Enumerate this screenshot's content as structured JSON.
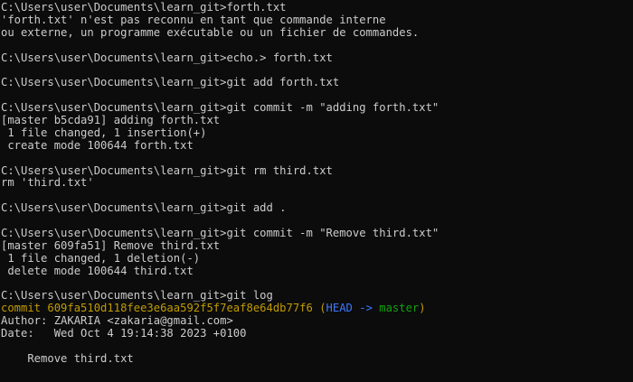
{
  "terminal": {
    "lines": [
      "C:\\Users\\user\\Documents\\learn_git>forth.txt",
      "'forth.txt' n'est pas reconnu en tant que commande interne",
      "ou externe, un programme exécutable ou un fichier de commandes.",
      "",
      "C:\\Users\\user\\Documents\\learn_git>echo.> forth.txt",
      "",
      "C:\\Users\\user\\Documents\\learn_git>git add forth.txt",
      "",
      "C:\\Users\\user\\Documents\\learn_git>git commit -m \"adding forth.txt\"",
      "[master b5cda91] adding forth.txt",
      " 1 file changed, 1 insertion(+)",
      " create mode 100644 forth.txt",
      "",
      "C:\\Users\\user\\Documents\\learn_git>git rm third.txt",
      "rm 'third.txt'",
      "",
      "C:\\Users\\user\\Documents\\learn_git>git add .",
      "",
      "C:\\Users\\user\\Documents\\learn_git>git commit -m \"Remove third.txt\"",
      "[master 609fa51] Remove third.txt",
      " 1 file changed, 1 deletion(-)",
      " delete mode 100644 third.txt",
      "",
      "C:\\Users\\user\\Documents\\learn_git>git log"
    ],
    "log": {
      "commit_prefix": "commit 609fa510d118fee3e6aa592f5f7eaf8e64db77f6 ",
      "paren_open": "(",
      "head": "HEAD -> ",
      "branch": "master",
      "paren_close": ")",
      "author": "Author: ZAKARIA <zakaria@gmail.com>",
      "date": "Date:   Wed Oct 4 19:14:38 2023 +0100",
      "blank": "",
      "message": "    Remove third.txt"
    },
    "colors": {
      "background": "#0c0c0c",
      "foreground": "#cccccc",
      "commit_hash": "#c19c00",
      "head": "#3b78ff",
      "branch": "#13a10e"
    }
  }
}
